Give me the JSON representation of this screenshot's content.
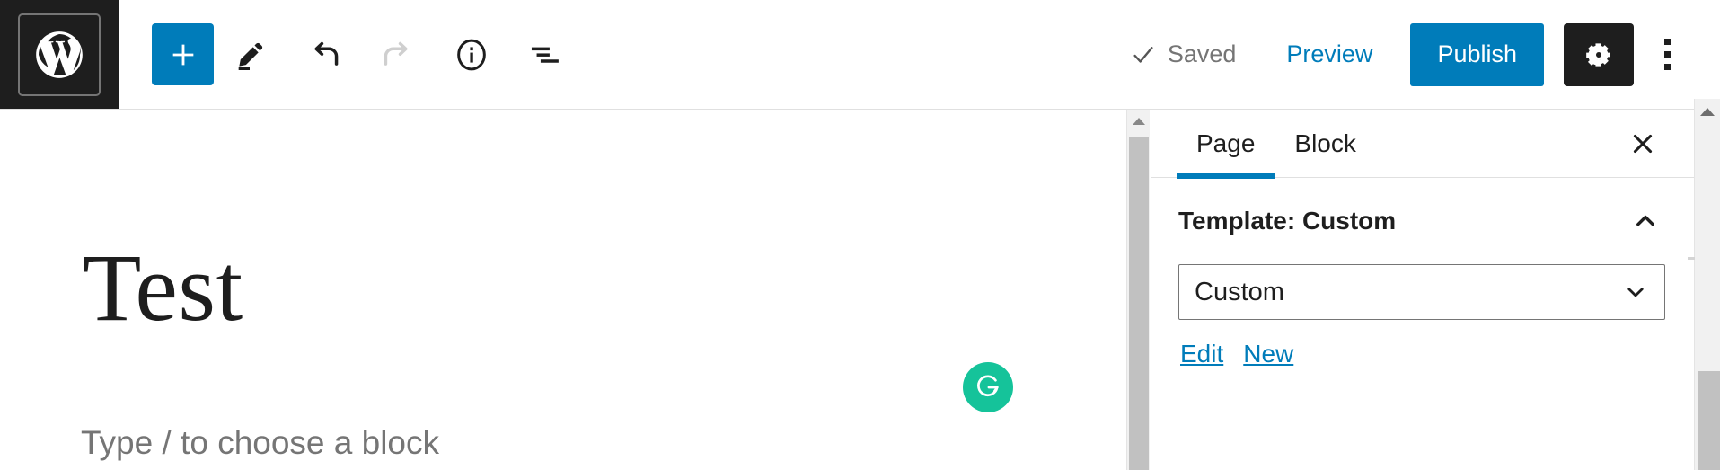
{
  "header": {
    "logo": {
      "icon": "wordpress-logo-icon",
      "label": "WordPress"
    },
    "tools": [
      {
        "name": "add-block-inserter",
        "icon": "plus-icon",
        "label": "Toggle block inserter",
        "state": "primary"
      },
      {
        "name": "edit-tool",
        "icon": "pencil-icon",
        "label": "Tools",
        "state": "active"
      },
      {
        "name": "undo",
        "icon": "undo-arrow-icon",
        "label": "Undo",
        "state": "enabled"
      },
      {
        "name": "redo",
        "icon": "redo-arrow-icon",
        "label": "Redo",
        "state": "disabled"
      },
      {
        "name": "details",
        "icon": "info-circle-icon",
        "label": "Details",
        "state": "enabled"
      },
      {
        "name": "list-view",
        "icon": "list-view-icon",
        "label": "List View",
        "state": "enabled"
      }
    ],
    "saved_label": "Saved",
    "saved_icon": "checkmark-icon",
    "preview_label": "Preview",
    "publish_label": "Publish",
    "settings_icon": "gear-icon",
    "settings_label": "Settings",
    "more_icon": "three-vertical-dots-icon",
    "more_label": "Options"
  },
  "editor": {
    "title": "Test",
    "block_placeholder": "Type / to choose a block",
    "grammarly": {
      "icon": "grammarly-g-icon",
      "letter": "G",
      "color": "#15c39a"
    }
  },
  "sidebar": {
    "tabs": [
      {
        "label": "Page",
        "active": true
      },
      {
        "label": "Block",
        "active": false
      }
    ],
    "close_icon": "close-x-icon",
    "close_label": "Close settings",
    "panel": {
      "title": "Template: Custom",
      "chevron_icon": "chevron-up-icon",
      "expanded": true,
      "select": {
        "value": "Custom",
        "options": [
          "Custom"
        ],
        "chevron_icon": "chevron-down-icon"
      },
      "links": [
        {
          "label": "Edit"
        },
        {
          "label": "New"
        }
      ]
    }
  },
  "scrollbars": {
    "canvas": {
      "arrow_icon": "scroll-up-arrow-icon"
    },
    "window": {
      "arrow_icon": "scroll-up-arrow-icon"
    }
  },
  "colors": {
    "accent": "#007cba",
    "dark": "#1e1e1e",
    "muted": "#757575",
    "grammarly_green": "#15c39a",
    "border": "#e0e0e0"
  }
}
